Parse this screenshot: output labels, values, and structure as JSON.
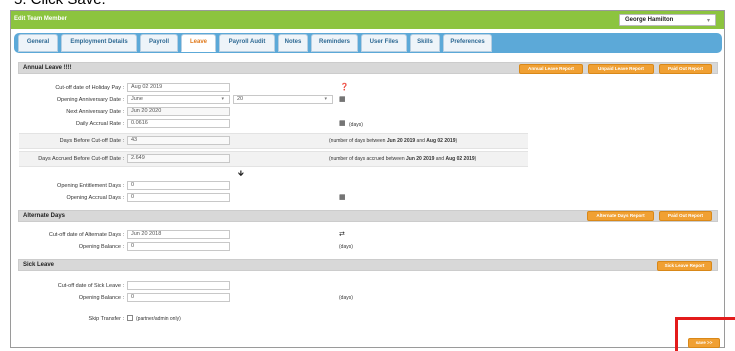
{
  "top_caption": "5. Click Save.",
  "window": {
    "title": "Edit Team Member",
    "member_select": "George Hamilton"
  },
  "tabs": [
    {
      "label": "General",
      "active": false
    },
    {
      "label": "Employment Details",
      "active": false
    },
    {
      "label": "Payroll",
      "active": false
    },
    {
      "label": "Leave",
      "active": true
    },
    {
      "label": "Payroll Audit",
      "active": false
    },
    {
      "label": "Notes",
      "active": false
    },
    {
      "label": "Reminders",
      "active": false
    },
    {
      "label": "User Files",
      "active": false
    },
    {
      "label": "Skills",
      "active": false
    },
    {
      "label": "Preferences",
      "active": false
    }
  ],
  "annual_leave": {
    "heading": "Annual Leave !!!!",
    "buttons": [
      "Annual Leave Report",
      "Unpaid Leave Report",
      "Paid Out Report"
    ],
    "fields": {
      "cutoff_label": "Cut-off date of Holiday Pay :",
      "cutoff_value": "Aug 02 2019",
      "opening_anniv_label": "Opening Anniversary Date :",
      "opening_anniv_month": "June",
      "opening_anniv_day": "20",
      "next_anniv_label": "Next Anniversary Date :",
      "next_anniv_value": "Jun 20 2020",
      "daily_accrual_label": "Daily Accrual Rate :",
      "daily_accrual_value": "0.0616",
      "daily_accrual_unit": "(days)",
      "days_before_label": "Days Before Cut-off Date :",
      "days_before_value": "43",
      "days_before_note_prefix": "(number of days between ",
      "days_before_note_from": "Jun 20 2019",
      "days_before_note_and": " and ",
      "days_before_note_to": "Aug 02 2019",
      "days_before_note_suffix": ")",
      "days_accrued_label": "Days Accrued Before Cut-off Date :",
      "days_accrued_value": "2.649",
      "days_accrued_note_prefix": "(number of days accrued between ",
      "days_accrued_note_from": "Jun 20 2019",
      "days_accrued_note_and": " and ",
      "days_accrued_note_to": "Aug 02 2019",
      "days_accrued_note_suffix": ")",
      "opening_ent_label": "Opening Entitlement Days :",
      "opening_ent_value": "0",
      "opening_accrual_label": "Opening Accrual Days :",
      "opening_accrual_value": "0"
    }
  },
  "alternate_days": {
    "heading": "Alternate Days",
    "buttons": [
      "Alternate Days Report",
      "Paid Out Report"
    ],
    "cutoff_label": "Cut-off date of Alternate Days :",
    "cutoff_value": "Jun 20 2018",
    "opening_balance_label": "Opening Balance :",
    "opening_balance_value": "0",
    "unit": "(days)"
  },
  "sick_leave": {
    "heading": "Sick Leave",
    "buttons": [
      "Sick Leave Report"
    ],
    "cutoff_label": "Cut-off date of Sick Leave :",
    "cutoff_value": "",
    "opening_balance_label": "Opening Balance :",
    "opening_balance_value": "0",
    "unit": "(days)"
  },
  "skip_transfer": {
    "label": "Skip Transfer :",
    "note": "(partner/admin only)"
  },
  "footer": {
    "next_label": "save >>"
  },
  "colors": {
    "title_bar": "#8cc43f",
    "tab_strip": "#5ca9d8",
    "orange_button": "#f0a033",
    "active_tab_text": "#e07a1c",
    "highlight_box": "#e31b1b"
  }
}
